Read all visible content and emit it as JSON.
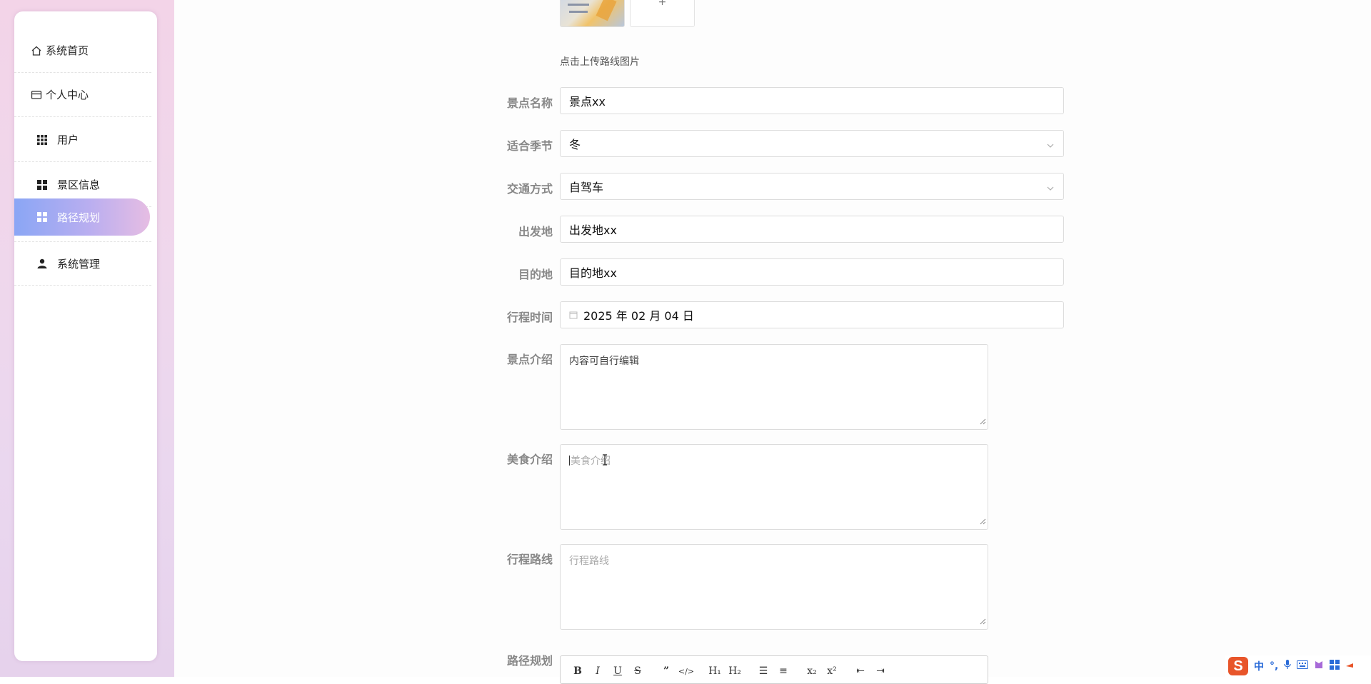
{
  "sidebar": {
    "items": [
      {
        "label": "系统首页",
        "icon": "home-icon",
        "active": false
      },
      {
        "label": "个人中心",
        "icon": "id-card-icon",
        "active": false
      },
      {
        "label": "用户",
        "icon": "grid-icon",
        "active": false
      },
      {
        "label": "景区信息",
        "icon": "apps-icon",
        "active": false
      },
      {
        "label": "路径规划",
        "icon": "apps-icon",
        "active": true
      },
      {
        "label": "系统管理",
        "icon": "user-icon",
        "active": false
      }
    ]
  },
  "upload": {
    "add_symbol": "+",
    "hint": "点击上传路线图片"
  },
  "form": {
    "scenic_name": {
      "label": "景点名称",
      "value": "景点xx"
    },
    "season": {
      "label": "适合季节",
      "value": "冬"
    },
    "transport": {
      "label": "交通方式",
      "value": "自驾车"
    },
    "departure": {
      "label": "出发地",
      "value": "出发地xx"
    },
    "destination": {
      "label": "目的地",
      "value": "目的地xx"
    },
    "trip_time": {
      "label": "行程时间",
      "value": "2025 年 02 月 04 日"
    },
    "scenic_intro": {
      "label": "景点介绍",
      "value": "内容可自行编辑"
    },
    "food_intro": {
      "label": "美食介绍",
      "placeholder": "美食介绍"
    },
    "trip_route": {
      "label": "行程路线",
      "placeholder": "行程路线"
    },
    "route_plan": {
      "label": "路径规划"
    }
  },
  "editor_toolbar": {
    "buttons": [
      {
        "name": "bold-button",
        "glyph": "B"
      },
      {
        "name": "italic-button",
        "glyph": "I"
      },
      {
        "name": "underline-button",
        "glyph": "U"
      },
      {
        "name": "strike-button",
        "glyph": "S"
      },
      {
        "name": "quote-button",
        "glyph": "”"
      },
      {
        "name": "code-button",
        "glyph": "</>"
      },
      {
        "name": "h1-button",
        "glyph": "H₁"
      },
      {
        "name": "h2-button",
        "glyph": "H₂"
      },
      {
        "name": "ordered-list-button",
        "glyph": "☰"
      },
      {
        "name": "bullet-list-button",
        "glyph": "≡"
      },
      {
        "name": "subscript-button",
        "glyph": "x₂"
      },
      {
        "name": "superscript-button",
        "glyph": "x²"
      },
      {
        "name": "outdent-button",
        "glyph": "⇤"
      },
      {
        "name": "indent-button",
        "glyph": "⇥"
      }
    ]
  },
  "ime": {
    "logo": "S",
    "lang": "中"
  },
  "colors": {
    "active_menu_start": "#8aa6f5",
    "active_menu_end": "#e6bde3",
    "label": "#888888"
  }
}
